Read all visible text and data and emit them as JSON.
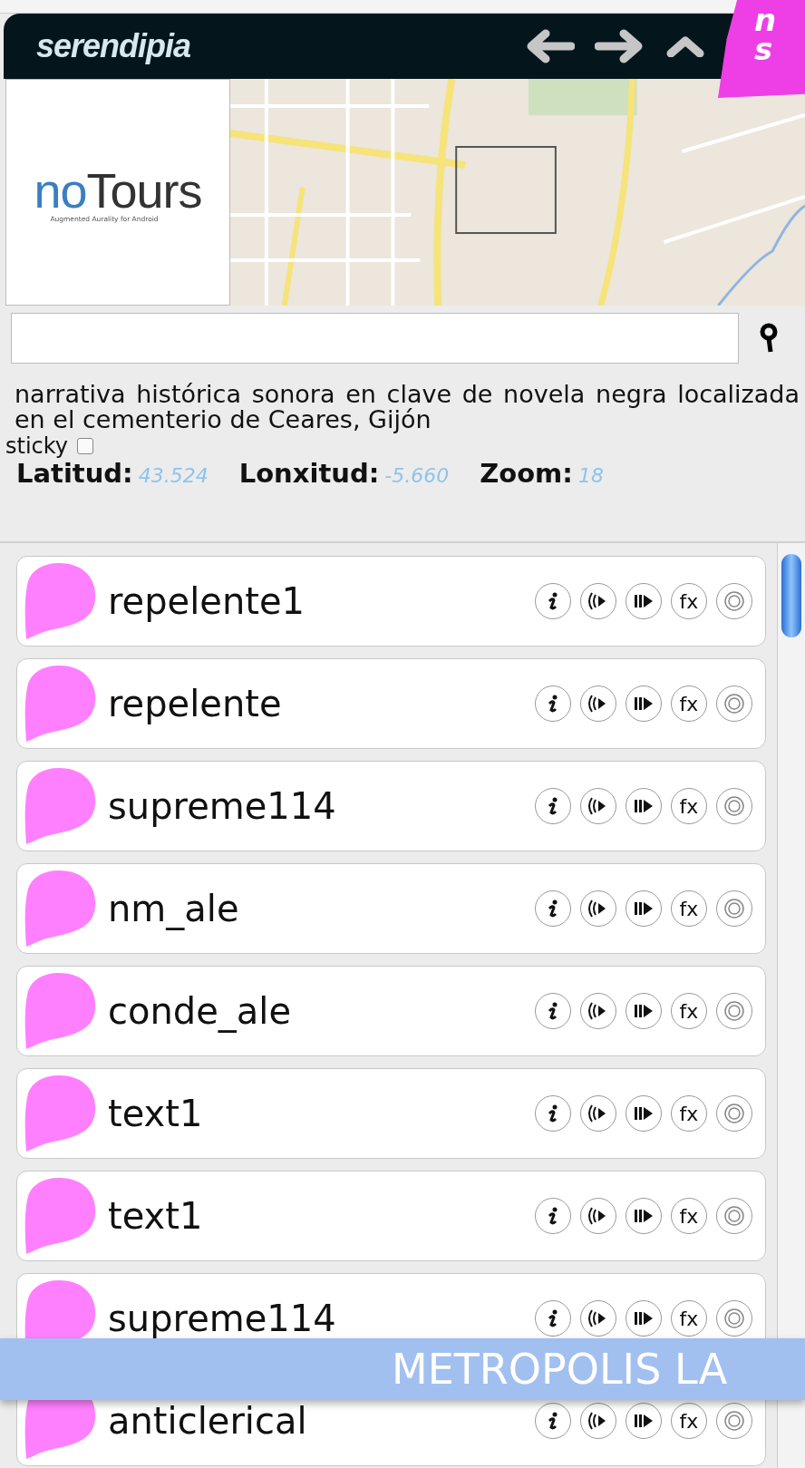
{
  "header": {
    "title": "serendipia"
  },
  "corner_badge": {
    "lines": [
      "n",
      "s"
    ]
  },
  "logo": {
    "name_part1": "no",
    "name_part2": "Tours",
    "tagline": "Augmented Aurality for Android"
  },
  "search": {
    "kind": "field"
  },
  "description": "narrativa histórica sonora en clave de novela negra localizada en el cementerio de Ceares, Gijón",
  "sticky": {
    "label": "sticky",
    "checked": false
  },
  "coords": [
    {
      "label": "Latitud:",
      "value": "43.524"
    },
    {
      "label": "Lonxitud:",
      "value": "-5.660"
    },
    {
      "label": "Zoom:",
      "value": "18"
    }
  ],
  "items": [
    {
      "name": "repelente1",
      "fx": "fx"
    },
    {
      "name": "repelente",
      "fx": "fx"
    },
    {
      "name": "supreme114",
      "fx": "fx"
    },
    {
      "name": "nm_ale",
      "fx": "fx"
    },
    {
      "name": "conde_ale",
      "fx": "fx"
    },
    {
      "name": "text1",
      "fx": "fx"
    },
    {
      "name": "text1",
      "fx": "fx"
    },
    {
      "name": "supreme114",
      "fx": "fx"
    },
    {
      "name": "anticlerical",
      "fx": "fx"
    }
  ],
  "banner": {
    "text": "METROPOLIS LA"
  }
}
